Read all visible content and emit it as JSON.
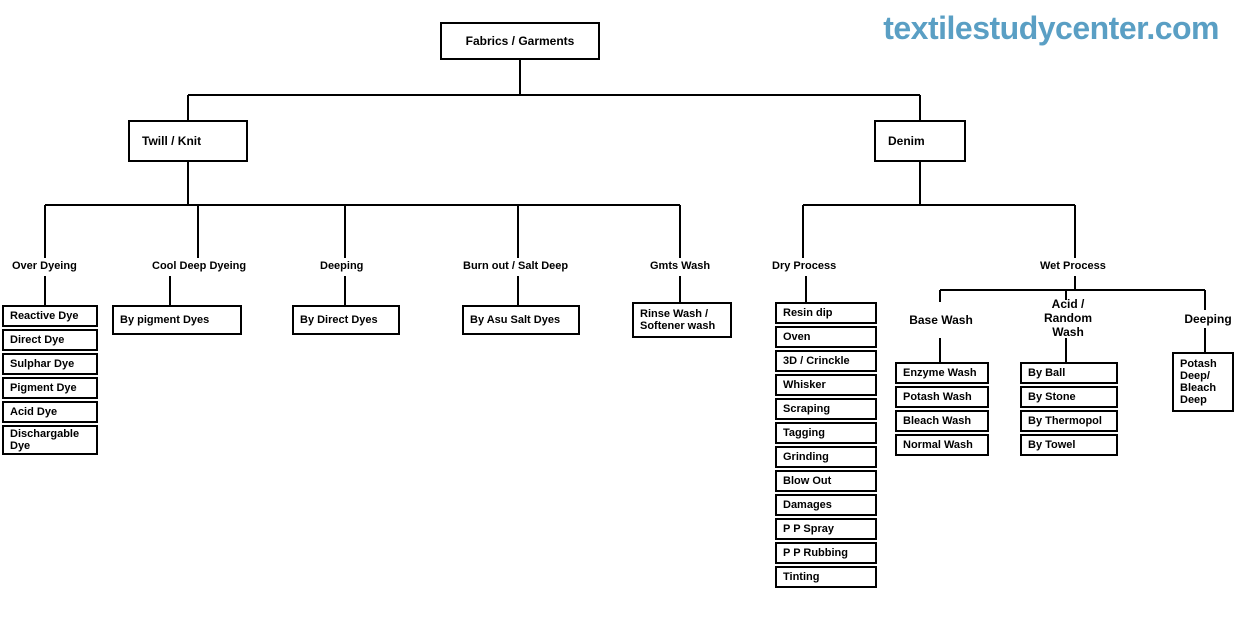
{
  "watermark": "textilestudycenter.com",
  "root": "Fabrics / Garments",
  "twill": {
    "label": "Twill / Knit",
    "over_dyeing": {
      "label": "Over Dyeing",
      "items": [
        "Reactive Dye",
        "Direct Dye",
        "Sulphar Dye",
        "Pigment Dye",
        "Acid Dye",
        "Dischargable Dye"
      ]
    },
    "cool_deep": {
      "label": "Cool Deep Dyeing",
      "item": "By pigment Dyes"
    },
    "deeping": {
      "label": "Deeping",
      "item": "By Direct Dyes"
    },
    "burnout": {
      "label": "Burn out / Salt Deep",
      "item": "By Asu Salt Dyes"
    },
    "gmts": {
      "label": "Gmts Wash",
      "item": "Rinse Wash / Softener wash"
    }
  },
  "denim": {
    "label": "Denim",
    "dry": {
      "label": "Dry Process",
      "items": [
        "Resin dip",
        "Oven",
        "3D / Crinckle",
        "Whisker",
        "Scraping",
        "Tagging",
        "Grinding",
        "Blow Out",
        "Damages",
        "P P Spray",
        "P P Rubbing",
        "Tinting"
      ]
    },
    "wet": {
      "label": "Wet Process",
      "base": {
        "label": "Base Wash",
        "items": [
          "Enzyme Wash",
          "Potash Wash",
          "Bleach Wash",
          "Normal Wash"
        ]
      },
      "acid": {
        "label": "Acid / Random Wash",
        "items": [
          "By Ball",
          "By Stone",
          "By Thermopol",
          "By Towel"
        ]
      },
      "deeping": {
        "label": "Deeping",
        "item": "Potash Deep/ Bleach Deep"
      }
    }
  }
}
